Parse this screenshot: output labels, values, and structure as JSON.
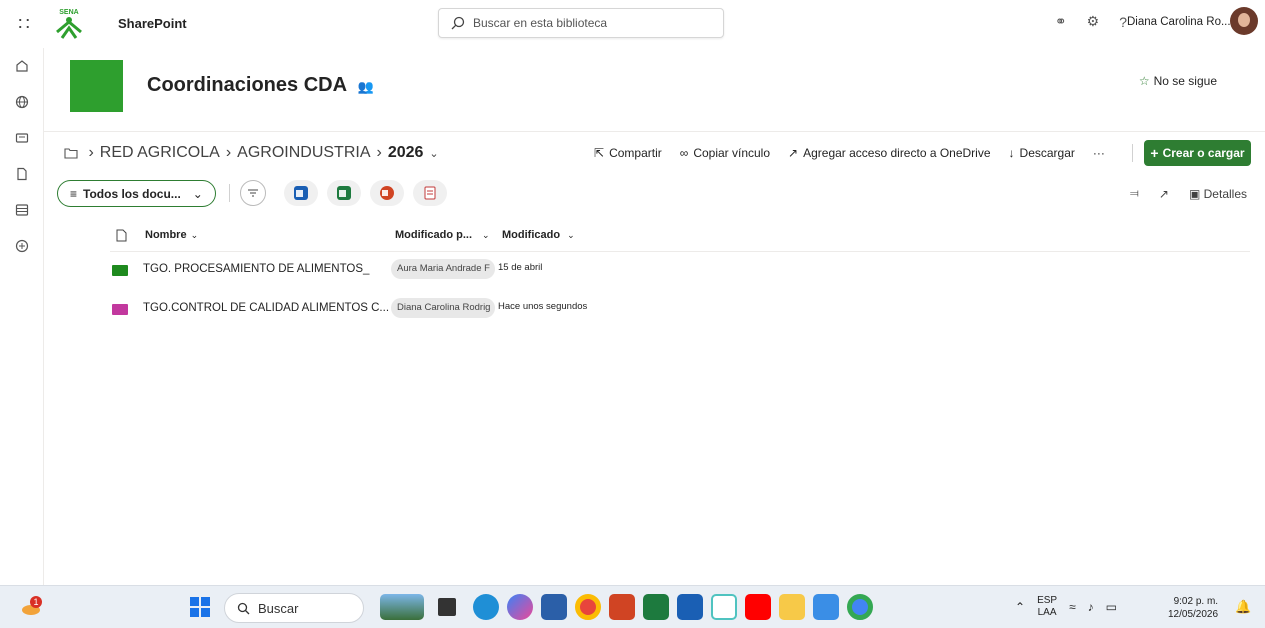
{
  "topbar": {
    "app_name": "SharePoint",
    "search_placeholder": "Buscar en esta biblioteca",
    "user_name": "Diana Carolina Ro...",
    "logo_text": "SENA"
  },
  "site": {
    "title": "Coordinaciones CDA",
    "follow_label": "No se sigue",
    "accent_color": "#2e9f2e"
  },
  "breadcrumb": {
    "items": [
      "RED AGRICOLA",
      "AGROINDUSTRIA"
    ],
    "current": "2026"
  },
  "actions": {
    "share": "Compartir",
    "copy_link": "Copiar vínculo",
    "add_shortcut": "Agregar acceso directo a OneDrive",
    "download": "Descargar",
    "more": "···",
    "create": "Crear o cargar"
  },
  "view": {
    "selected": "Todos los docu...",
    "details": "Detalles"
  },
  "list": {
    "columns": {
      "name": "Nombre",
      "modified_by": "Modificado p...",
      "modified": "Modificado"
    },
    "rows": [
      {
        "name": "TGO. PROCESAMIENTO DE ALIMENTOS_",
        "modified_by": "Aura Maria Andrade F",
        "modified": "15 de abril",
        "folder_color": "#1e8a1e"
      },
      {
        "name": "TGO.CONTROL DE CALIDAD ALIMENTOS C...",
        "modified_by": "Diana Carolina Rodrig",
        "modified": "Hace unos segundos",
        "folder_color": "#c2389e"
      }
    ]
  },
  "taskbar": {
    "search_label": "Buscar",
    "weather_badge": "1",
    "lang_top": "ESP",
    "lang_bottom": "LAA",
    "time": "9:02 p. m.",
    "date": "12/05/2026"
  }
}
